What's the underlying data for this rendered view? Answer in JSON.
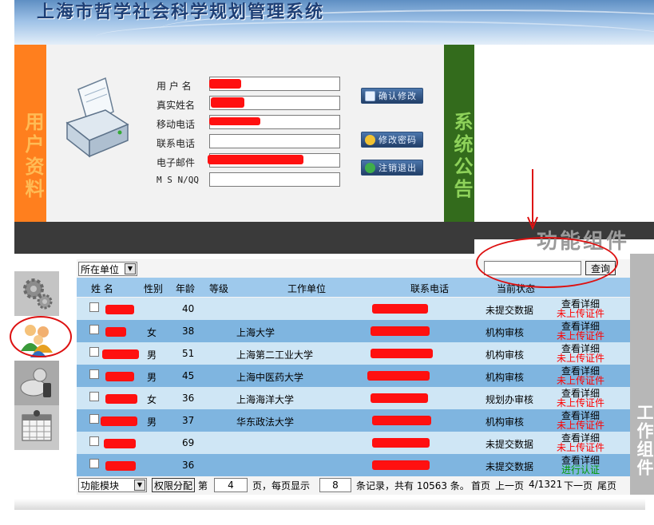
{
  "app": {
    "title": "上海市哲学社会科学规划管理系统"
  },
  "user_panel": {
    "tab_label": "用户资料",
    "fields": [
      {
        "label": "用 户 名",
        "value": ""
      },
      {
        "label": "真实姓名",
        "value": ""
      },
      {
        "label": "移动电话",
        "value": ""
      },
      {
        "label": "联系电话",
        "value": ""
      },
      {
        "label": "电子邮件",
        "value": ""
      },
      {
        "label": "M S N/QQ",
        "value": ""
      }
    ],
    "buttons": {
      "confirm": "确认修改",
      "password": "修改密码",
      "logout": "注销退出"
    },
    "icon": "printer-icon"
  },
  "notice_panel": {
    "tab_label": "系统公告"
  },
  "function_bar": {
    "title": "功能组件"
  },
  "side_icons": [
    "gear-icon",
    "users-icon",
    "phone-icon",
    "calendar-icon"
  ],
  "toolbar": {
    "dept_select": "所在单位",
    "search_placeholder": "",
    "search_button": "查询"
  },
  "table": {
    "columns": [
      "姓 名",
      "性别",
      "年龄",
      "等级",
      "工作单位",
      "联系电话",
      "当前状态"
    ],
    "rows": [
      {
        "gender": "",
        "age": "40",
        "level": "",
        "unit": "",
        "status": "未提交数据",
        "detail": "查看详细",
        "sub": "未上传证件"
      },
      {
        "gender": "女",
        "age": "38",
        "level": "",
        "unit": "上海大学",
        "status": "机构审核",
        "detail": "查看详细",
        "sub": "未上传证件"
      },
      {
        "gender": "男",
        "age": "51",
        "level": "",
        "unit": "上海第二工业大学",
        "status": "机构审核",
        "detail": "查看详细",
        "sub": "未上传证件"
      },
      {
        "gender": "男",
        "age": "45",
        "level": "",
        "unit": "上海中医药大学",
        "status": "机构审核",
        "detail": "查看详细",
        "sub": "未上传证件"
      },
      {
        "gender": "女",
        "age": "36",
        "level": "",
        "unit": "上海海洋大学",
        "status": "规划办审核",
        "detail": "查看详细",
        "sub": "未上传证件"
      },
      {
        "gender": "男",
        "age": "37",
        "level": "",
        "unit": "华东政法大学",
        "status": "机构审核",
        "detail": "查看详细",
        "sub": "未上传证件"
      },
      {
        "gender": "",
        "age": "69",
        "level": "",
        "unit": "",
        "status": "未提交数据",
        "detail": "查看详细",
        "sub": "未上传证件"
      },
      {
        "gender": "",
        "age": "36",
        "level": "",
        "unit": "",
        "status": "未提交数据",
        "detail": "查看详细",
        "sub": "进行认证"
      }
    ]
  },
  "footer": {
    "module_select": "功能模块",
    "perm_button": "权限分配",
    "page_prefix": "第",
    "page_num": "4",
    "per_page_text": "页，每页显示",
    "per_page": "8",
    "records_text": "条记录，共有 10563 条。",
    "first": "首页",
    "prev": "上一页",
    "page_info": "4/1321",
    "next": "下一页",
    "last": "尾页"
  },
  "right_strip": {
    "label": "工作组件"
  },
  "colors": {
    "user_tab": "#ff7f1e",
    "notice_tab": "#336b1c",
    "row_light": "#cfe6f5",
    "row_dark": "#7fb5e0",
    "redaction": "#ff1010",
    "annotation": "#dd1111"
  }
}
